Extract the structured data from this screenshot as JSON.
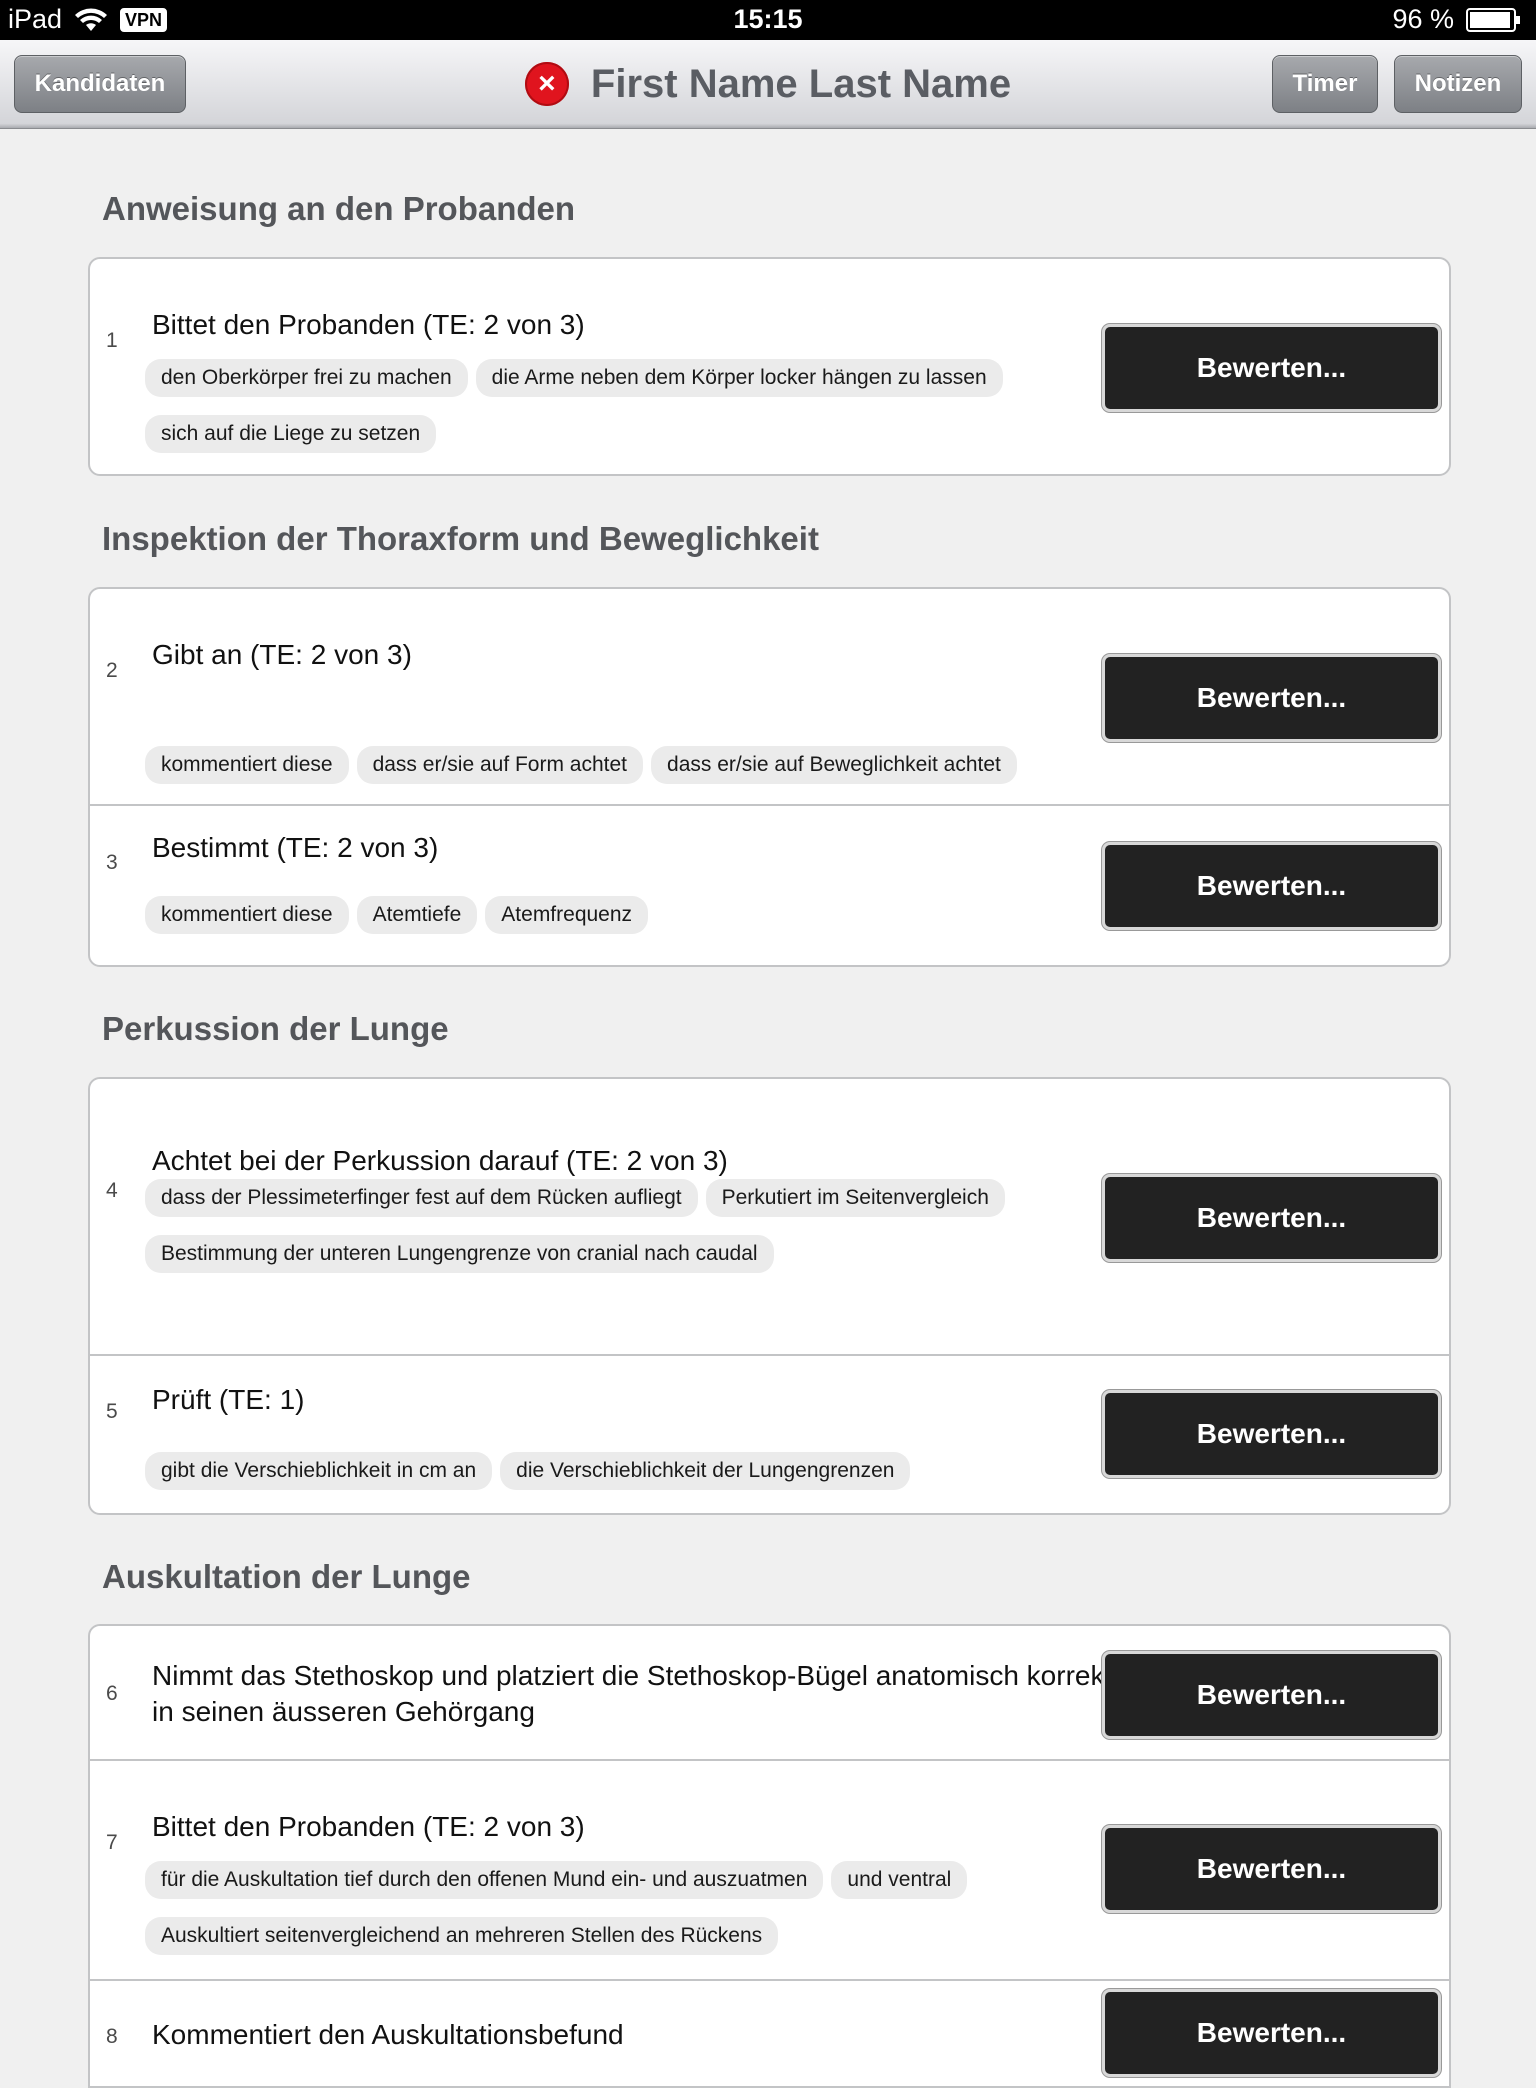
{
  "status": {
    "carrier": "iPad",
    "vpn": "VPN",
    "time": "15:15",
    "battery": "96 %"
  },
  "nav": {
    "left_button": "Kandidaten",
    "close_symbol": "×",
    "title": "First Name Last Name",
    "timer_button": "Timer",
    "notes_button": "Notizen"
  },
  "rate_label": "Bewerten...",
  "sections": [
    {
      "title": "Anweisung an den Probanden",
      "items": [
        {
          "num": "1",
          "text": "Bittet den Probanden (TE: 2 von 3)",
          "tags": [
            "den Oberkörper frei zu machen",
            "die Arme neben dem Körper locker hängen zu lassen",
            "sich auf die Liege zu setzen"
          ]
        }
      ]
    },
    {
      "title": "Inspektion der Thoraxform und Beweglichkeit",
      "items": [
        {
          "num": "2",
          "text": "Gibt an (TE: 2 von 3)",
          "tags": [
            "kommentiert diese",
            "dass er/sie auf Form achtet",
            "dass er/sie auf Beweglichkeit achtet"
          ]
        },
        {
          "num": "3",
          "text": "Bestimmt (TE: 2 von 3)",
          "tags": [
            "kommentiert diese",
            "Atemtiefe",
            "Atemfrequenz"
          ]
        }
      ]
    },
    {
      "title": "Perkussion der Lunge",
      "items": [
        {
          "num": "4",
          "text": "Achtet bei der Perkussion darauf (TE: 2 von 3)",
          "tags": [
            "dass der Plessimeterfinger fest auf dem Rücken aufliegt",
            "Perkutiert im Seitenvergleich",
            "Bestimmung der unteren Lungengrenze von cranial nach caudal"
          ]
        },
        {
          "num": "5",
          "text": "Prüft (TE: 1)",
          "tags": [
            "gibt die Verschieblichkeit in cm an",
            "die Verschieblichkeit der Lungengrenzen"
          ]
        }
      ]
    },
    {
      "title": "Auskultation der Lunge",
      "items": [
        {
          "num": "6",
          "text": "Nimmt das Stethoskop und platziert die Stethoskop-Bügel anatomisch korrekt in seinen äusseren Gehörgang",
          "tags": []
        },
        {
          "num": "7",
          "text": "Bittet den Probanden (TE: 2 von 3)",
          "tags": [
            "für die Auskultation tief durch den offenen Mund ein- und auszuatmen",
            "und ventral",
            "Auskultiert seitenvergleichend an mehreren Stellen des Rückens"
          ]
        },
        {
          "num": "8",
          "text": "Kommentiert den Auskultationsbefund",
          "tags": []
        }
      ]
    }
  ]
}
